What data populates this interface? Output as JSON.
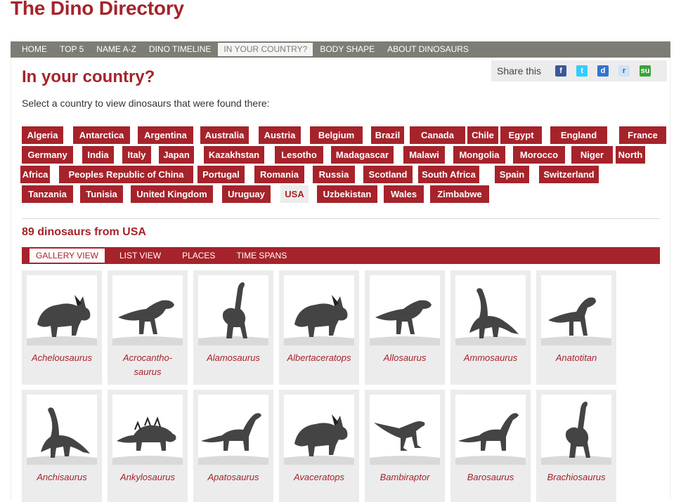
{
  "site": {
    "title": "The Dino Directory"
  },
  "nav": [
    "HOME",
    "TOP 5",
    "NAME A-Z",
    "DINO TIMELINE",
    "IN YOUR COUNTRY?",
    "BODY SHAPE",
    "ABOUT DINOSAURS"
  ],
  "nav_active": "IN YOUR COUNTRY?",
  "page": {
    "title": "In your country?",
    "intro": "Select a country to view dinosaurs that were found there:"
  },
  "share": {
    "label": "Share this",
    "icons": [
      {
        "name": "facebook-icon",
        "glyph": "f",
        "color": "#3b5998"
      },
      {
        "name": "twitter-icon",
        "glyph": "t",
        "color": "#33ccff"
      },
      {
        "name": "delicious-icon",
        "glyph": "d",
        "color": "#3274d1"
      },
      {
        "name": "reddit-icon",
        "glyph": "r",
        "color": "#cee3f8"
      },
      {
        "name": "stumbleupon-icon",
        "glyph": "su",
        "color": "#3aa33a"
      }
    ]
  },
  "countries": [
    "Algeria",
    "Antarctica",
    "Argentina",
    "Australia",
    "Austria",
    "Belgium",
    "Brazil",
    "Canada",
    "Chile",
    "Egypt",
    "England",
    "France",
    "Germany",
    "India",
    "Italy",
    "Japan",
    "Kazakhstan",
    "Lesotho",
    "Madagascar",
    "Malawi",
    "Mongolia",
    "Morocco",
    "Niger",
    "North Africa",
    "Peoples Republic of China",
    "Portugal",
    "Romania",
    "Russia",
    "Scotland",
    "South Africa",
    "Spain",
    "Switzerland",
    "Tanzania",
    "Tunisia",
    "United Kingdom",
    "Uruguay",
    "USA",
    "Uzbekistan",
    "Wales",
    "Zimbabwe"
  ],
  "selected_country": "USA",
  "results": {
    "heading": "89 dinosaurs from USA"
  },
  "view_tabs": [
    "GALLERY VIEW",
    "LIST VIEW",
    "PLACES",
    "TIME SPANS"
  ],
  "view_active": "GALLERY VIEW",
  "dinosaurs": [
    {
      "name": "Achelousaurus",
      "shape": "ceratopsian"
    },
    {
      "name": "Acrocantho-saurus",
      "shape": "theropod"
    },
    {
      "name": "Alamosaurus",
      "shape": "sauropod-tall"
    },
    {
      "name": "Albertaceratops",
      "shape": "ceratopsian"
    },
    {
      "name": "Allosaurus",
      "shape": "theropod"
    },
    {
      "name": "Ammosaurus",
      "shape": "prosauropod"
    },
    {
      "name": "Anatotitan",
      "shape": "hadrosaur"
    },
    {
      "name": "Anchisaurus",
      "shape": "prosauropod"
    },
    {
      "name": "Ankylosaurus",
      "shape": "ankylosaur"
    },
    {
      "name": "Apatosaurus",
      "shape": "sauropod"
    },
    {
      "name": "Avaceratops",
      "shape": "ceratopsian"
    },
    {
      "name": "Bambiraptor",
      "shape": "raptor"
    },
    {
      "name": "Barosaurus",
      "shape": "sauropod"
    },
    {
      "name": "Brachiosaurus",
      "shape": "sauropod-tall"
    }
  ]
}
